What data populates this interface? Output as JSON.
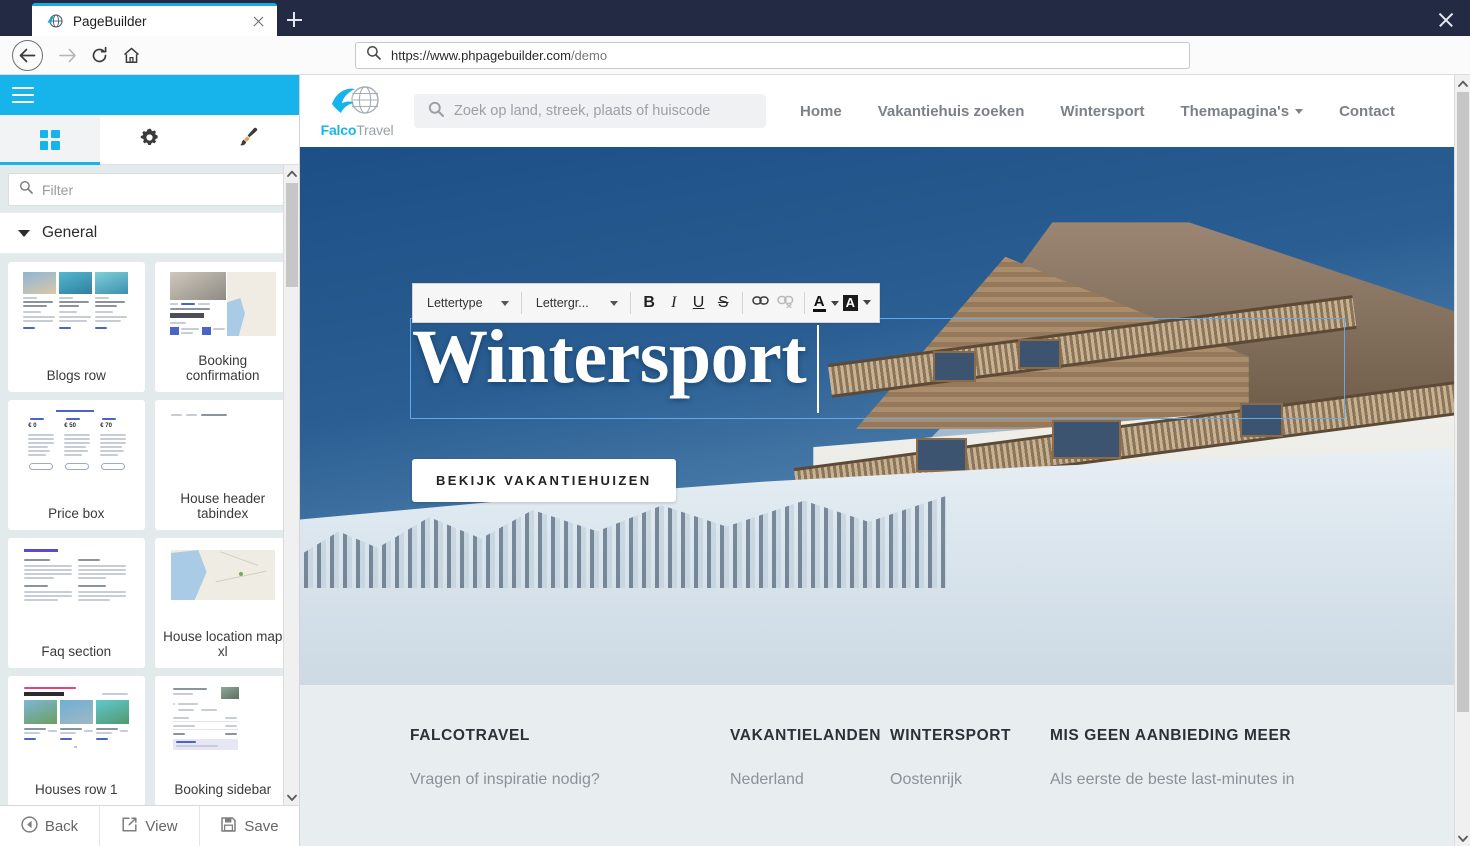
{
  "browser": {
    "tab_title": "PageBuilder",
    "tab_favicon": "globe-icon",
    "url_secure": "https://www.phpagebuilder.com",
    "url_path": "/demo",
    "back_icon": "arrow-left-icon",
    "forward_icon": "arrow-right-icon",
    "reload_icon": "reload-icon",
    "home_icon": "home-icon",
    "new_tab_icon": "plus-icon",
    "close_window_icon": "close-icon"
  },
  "builder": {
    "menu_icon": "hamburger-icon",
    "tabs": [
      {
        "name": "blocks",
        "icon": "grid-icon",
        "active": true
      },
      {
        "name": "settings",
        "icon": "gear-icon",
        "active": false
      },
      {
        "name": "styles",
        "icon": "paintbrush-icon",
        "active": false
      }
    ],
    "filter_placeholder": "Filter",
    "filter_value": "",
    "section_title": "General",
    "blocks": [
      {
        "label": "Blogs row",
        "thumb": "blog-cards-thumb"
      },
      {
        "label": "Booking confirmation",
        "thumb": "booking-map-thumb"
      },
      {
        "label": "Price box",
        "thumb": "pricing-table-thumb"
      },
      {
        "label": "House header tabindex",
        "thumb": "house-header-thumb"
      },
      {
        "label": "Faq section",
        "thumb": "faq-text-thumb"
      },
      {
        "label": "House location map xl",
        "thumb": "map-thumb"
      },
      {
        "label": "Houses row 1",
        "thumb": "houses-cards-thumb"
      },
      {
        "label": "Booking sidebar",
        "thumb": "booking-sidebar-thumb"
      }
    ],
    "footer_buttons": [
      {
        "label": "Back",
        "icon": "back-circle-icon"
      },
      {
        "label": "View",
        "icon": "external-link-icon"
      },
      {
        "label": "Save",
        "icon": "floppy-disk-icon"
      }
    ]
  },
  "editor_toolbar": {
    "font_family_label": "Lettertype",
    "font_size_label": "Lettergr...",
    "buttons": [
      {
        "name": "bold",
        "glyph": "B"
      },
      {
        "name": "italic",
        "glyph": "I"
      },
      {
        "name": "underline",
        "glyph": "U"
      },
      {
        "name": "strikethrough",
        "glyph": "S"
      }
    ],
    "link_icon": "link-icon",
    "unlink_icon": "unlink-icon",
    "text_color_glyph": "A",
    "highlight_color_glyph": "A"
  },
  "site": {
    "logo_primary": "Falco",
    "logo_secondary": "Travel",
    "logo_icon": "falcon-globe-icon",
    "search_icon": "search-icon",
    "search_placeholder": "Zoek op land, streek, plaats of huiscode",
    "search_value": "",
    "nav": [
      {
        "label": "Home",
        "dropdown": false
      },
      {
        "label": "Vakantiehuis zoeken",
        "dropdown": false
      },
      {
        "label": "Wintersport",
        "dropdown": false
      },
      {
        "label": "Themapagina's",
        "dropdown": true
      },
      {
        "label": "Contact",
        "dropdown": false
      }
    ],
    "hero": {
      "title": "Wintersport",
      "cta_label": "BEKIJK VAKANTIEHUIZEN",
      "image_alt": "snow-covered alpine chalet"
    },
    "footer": {
      "columns": [
        {
          "heading": "FALCOTRAVEL",
          "text": "Vragen of inspiratie nodig?"
        },
        {
          "heading": "VAKANTIELANDEN",
          "text": "Nederland"
        },
        {
          "heading": "WINTERSPORT",
          "text": "Oostenrijk"
        },
        {
          "heading": "MIS GEEN AANBIEDING MEER",
          "text": "Als eerste de beste last-minutes in"
        }
      ]
    }
  },
  "colors": {
    "brand_blue": "#17b4ec",
    "titlebar": "#222a44",
    "panel_bg": "#e9eff1",
    "hero_sky": "#2b5f93",
    "selection_outline": "#63a8e8",
    "footer_bg": "#e8edf0"
  }
}
